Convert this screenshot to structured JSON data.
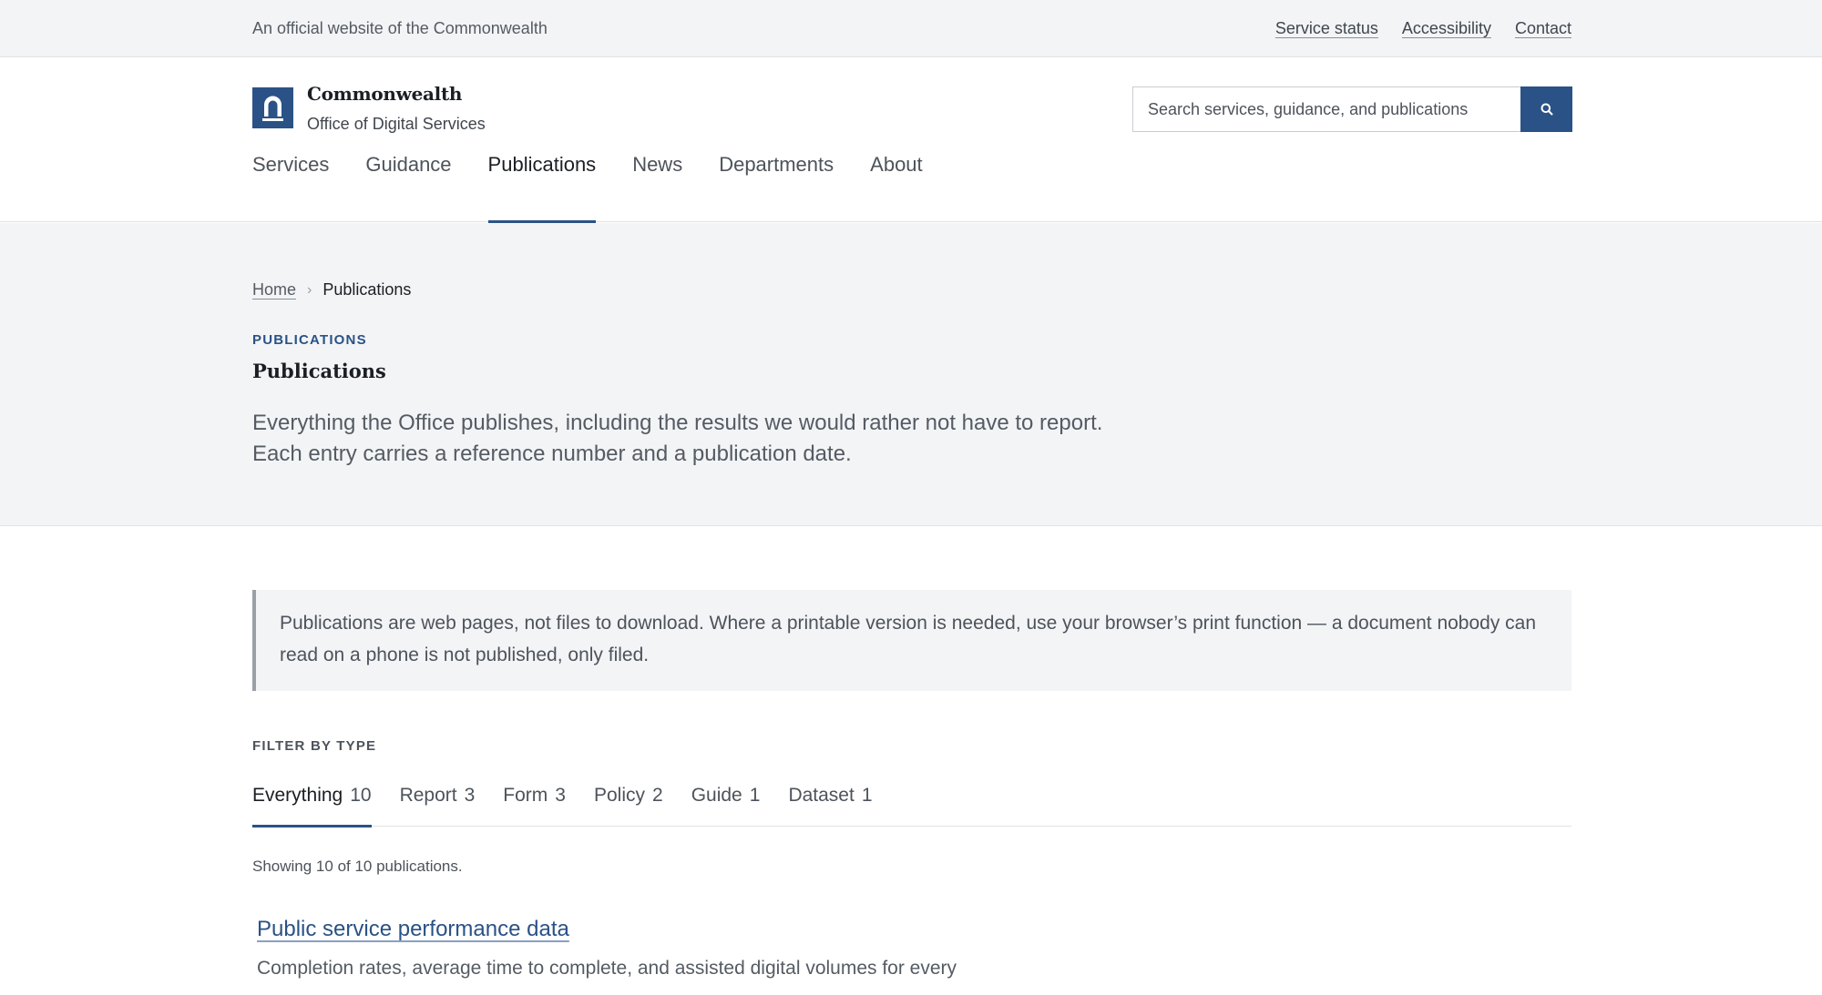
{
  "topbar": {
    "official_text": "An official website of the Commonwealth",
    "links": [
      {
        "label": "Service status"
      },
      {
        "label": "Accessibility"
      },
      {
        "label": "Contact"
      }
    ]
  },
  "header": {
    "brand_name": "Commonwealth",
    "brand_sub": "Office of Digital Services",
    "search_placeholder": "Search services, guidance, and publications",
    "search_icon": "search-icon",
    "logo_icon": "arch-icon"
  },
  "nav": {
    "items": [
      {
        "label": "Services"
      },
      {
        "label": "Guidance"
      },
      {
        "label": "Publications",
        "active": true
      },
      {
        "label": "News"
      },
      {
        "label": "Departments"
      },
      {
        "label": "About"
      }
    ]
  },
  "hero": {
    "breadcrumb_home": "Home",
    "breadcrumb_sep": "›",
    "breadcrumb_current": "Publications",
    "eyebrow": "PUBLICATIONS",
    "title": "Publications",
    "lede": "Everything the Office publishes, including the results we would rather not have to report. Each entry carries a reference number and a publication date."
  },
  "notice": {
    "text": "Publications are web pages, not files to download. Where a printable version is needed, use your browser’s print function — a document nobody can read on a phone is not published, only filed."
  },
  "filter": {
    "label": "FILTER BY TYPE",
    "tabs": [
      {
        "label": "Everything",
        "count": "10",
        "active": true
      },
      {
        "label": "Report",
        "count": "3"
      },
      {
        "label": "Form",
        "count": "3"
      },
      {
        "label": "Policy",
        "count": "2"
      },
      {
        "label": "Guide",
        "count": "1"
      },
      {
        "label": "Dataset",
        "count": "1"
      }
    ],
    "showing": "Showing 10 of 10 publications."
  },
  "results": [
    {
      "title": "Public service performance data",
      "summary": "Completion rates, average time to complete, and assisted digital volumes for every"
    }
  ],
  "colors": {
    "brand": "#2a5286",
    "muted_bg": "#f3f4f6"
  }
}
